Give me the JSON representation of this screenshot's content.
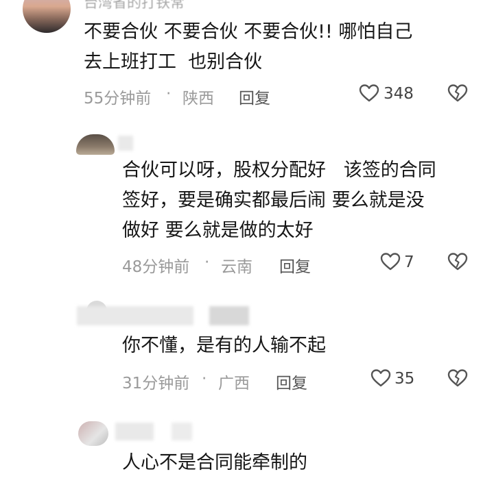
{
  "comments": [
    {
      "username": "台湾省的打铁常",
      "lines": [
        "不要合伙 不要合伙 不要合伙!! 哪怕自己",
        "去上班打工  也别合伙"
      ],
      "time": "55分钟前",
      "location": "陕西",
      "reply_label": "回复",
      "likes": "348"
    },
    {
      "username": "",
      "lines": [
        "合伙可以呀，股权分配好   该签的合同",
        "签好，要是确实都最后闹 要么就是没",
        "做好 要么就是做的太好"
      ],
      "time": "48分钟前",
      "location": "云南",
      "reply_label": "回复",
      "likes": "7"
    },
    {
      "username": "",
      "lines": [
        "你不懂，是有的人输不起"
      ],
      "time": "31分钟前",
      "location": "广西",
      "reply_label": "回复",
      "likes": "35"
    },
    {
      "username": "",
      "lines": [
        "人心不是合同能牵制的"
      ]
    }
  ],
  "meta_separator": "·",
  "icons": {
    "like": "heart-outline-icon",
    "dislike": "broken-heart-icon"
  },
  "colors": {
    "text": "#161616",
    "meta": "#9a9a9a",
    "icon": "#555555"
  }
}
